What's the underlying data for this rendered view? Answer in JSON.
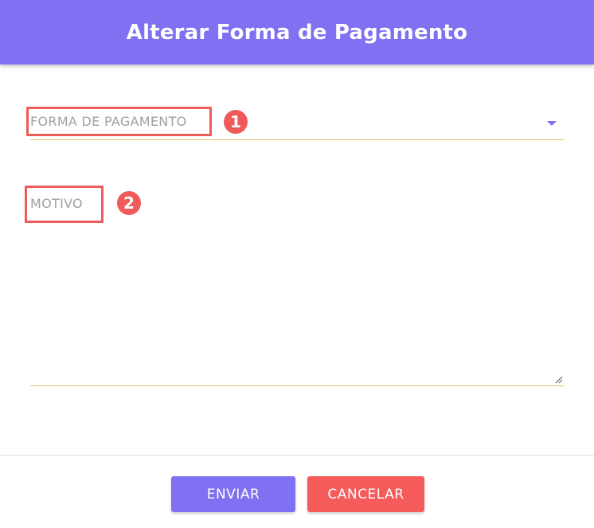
{
  "header": {
    "title": "Alterar Forma de Pagamento"
  },
  "form": {
    "payment_method_label": "FORMA DE PAGAMENTO",
    "reason_label": "MOTIVO"
  },
  "callouts": [
    "1",
    "2"
  ],
  "footer": {
    "submit_label": "ENVIAR",
    "cancel_label": "CANCELAR"
  },
  "colors": {
    "accent": "#8070f2",
    "danger": "#f55b5b",
    "field_underline": "#e9c46a",
    "callout": "#ef5b5b"
  },
  "icons": {
    "dropdown": "chevron-down-icon",
    "resize": "resize-grip-icon"
  }
}
